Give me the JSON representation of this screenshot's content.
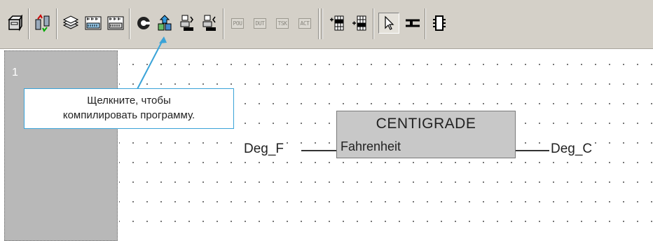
{
  "toolbar": {
    "items": [
      {
        "icon": "project-icon"
      },
      {
        "icon": "transfer-icon"
      },
      {
        "icon": "convert-all-icon"
      },
      {
        "icon": "compile-icon"
      },
      {
        "icon": "compile-program-icon"
      },
      {
        "icon": "online-icon"
      },
      {
        "icon": "monitor-icon"
      },
      {
        "icon": "write-plc-icon"
      },
      {
        "icon": "read-plc-icon"
      },
      {
        "icon": "insert-rung-icon"
      },
      {
        "icon": "append-rung-icon"
      },
      {
        "icon": "select-mode-icon"
      },
      {
        "icon": "contact-icon"
      },
      {
        "icon": "function-block-icon"
      }
    ],
    "disabled_labels": [
      "POU",
      "DUT",
      "TSK",
      "ACT"
    ]
  },
  "rung": {
    "number": "1"
  },
  "diagram": {
    "input_variable": "Deg_F",
    "block_name": "CENTIGRADE",
    "block_input": "Fahrenheit",
    "output_variable": "Deg_C"
  },
  "callout": {
    "line1": "Щелкните, чтобы",
    "line2": "компилировать программу."
  },
  "colors": {
    "toolbar_bg": "#d4d0c8",
    "rung_panel_bg": "#b8b8b8",
    "block_bg": "#c8c8c8",
    "callout_accent": "#3aa3d8"
  }
}
